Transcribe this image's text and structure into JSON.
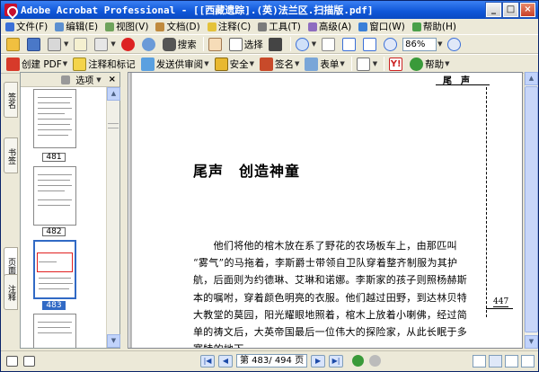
{
  "window": {
    "title": "Adobe Acrobat Professional - [[西藏遗踪].(英)法兰区.扫描版.pdf]",
    "controls": {
      "minimize": "_",
      "maximize": "□",
      "close": "×"
    }
  },
  "menubar": {
    "items": [
      {
        "label": "文件(F)",
        "icon": "file-menu-icon",
        "color": "#3a6fd8"
      },
      {
        "label": "编辑(E)",
        "icon": "edit-menu-icon",
        "color": "#5b8fd0"
      },
      {
        "label": "视图(V)",
        "icon": "view-menu-icon",
        "color": "#6fa35c"
      },
      {
        "label": "文档(D)",
        "icon": "document-menu-icon",
        "color": "#c08a3e"
      },
      {
        "label": "注释(C)",
        "icon": "comment-menu-icon",
        "color": "#e4c23a"
      },
      {
        "label": "工具(T)",
        "icon": "tools-menu-icon",
        "color": "#7b7b7b"
      },
      {
        "label": "高级(A)",
        "icon": "advanced-menu-icon",
        "color": "#8e6cc0"
      },
      {
        "label": "窗口(W)",
        "icon": "window-menu-icon",
        "color": "#3a7fd8"
      },
      {
        "label": "帮助(H)",
        "icon": "help-menu-icon",
        "color": "#4aa04a"
      }
    ]
  },
  "toolbar1": {
    "search_label": "搜索",
    "select_label": "选择",
    "zoom_value": "86%"
  },
  "toolbar2": {
    "create_pdf": "创建 PDF",
    "comment_markup": "注释和标记",
    "send_review": "发送供审阅",
    "security": "安全",
    "sign": "签名",
    "forms": "表单",
    "help": "帮助"
  },
  "nav_tabs": [
    "签名",
    "书签",
    "页面",
    "注释"
  ],
  "pages_panel": {
    "options_label": "选项",
    "close": "×",
    "thumbnails": [
      {
        "label": "481",
        "selected": false
      },
      {
        "label": "482",
        "selected": false
      },
      {
        "label": "483",
        "selected": true
      },
      {
        "label": "",
        "selected": false
      }
    ]
  },
  "document": {
    "running_head": "尾声",
    "chapter_title": "尾声　创造神童",
    "paragraph_lines": [
      "　　他们将他的棺木放在系了野花的农场板车上，由那匹叫",
      "“雾气”的马拖着，李斯爵士带领自卫队穿着整齐制服为其护",
      "航，后面则为约德琳、艾琳和诺娜。李斯家的孩子则照杨赫斯",
      "本的嘱咐，穿着颜色明亮的衣服。他们越过田野，到达林贝特",
      "大教堂的莫园，阳光耀眼地照着，棺木上放着小喇佛，经过简",
      "单的祷文后，大英帝国最后一位伟大的探险家，从此长眠于多",
      "塞特的地下。"
    ],
    "page_number": "447"
  },
  "statusbar": {
    "page_display": "第 483/ 494 页"
  }
}
